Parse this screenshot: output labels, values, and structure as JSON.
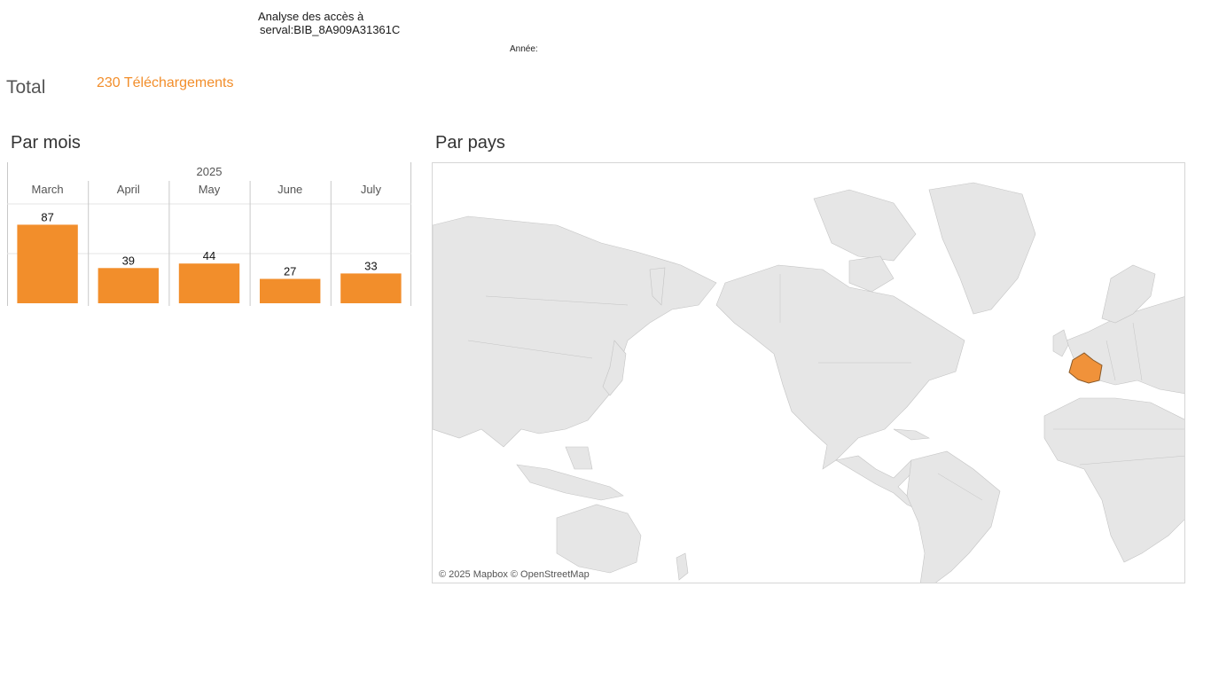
{
  "header": {
    "title_line1": "Analyse des accès à",
    "title_line2": "serval:BIB_8A909A31361C",
    "year_label": "Année:"
  },
  "summary": {
    "total_label": "Total",
    "total_value": "230 Téléchargements"
  },
  "sections": {
    "by_month": "Par mois",
    "by_country": "Par pays"
  },
  "chart_data": {
    "type": "bar",
    "group_label": "2025",
    "categories": [
      "March",
      "April",
      "May",
      "June",
      "July"
    ],
    "values": [
      87,
      39,
      44,
      27,
      33
    ],
    "show_data_labels": true,
    "grid": true
  },
  "map": {
    "attribution": "© 2025 Mapbox © OpenStreetMap",
    "highlighted_countries": [
      "France"
    ]
  },
  "colors": {
    "accent": "#f28e2b",
    "bar": "#f28e2b",
    "highlight_country": "#f0923a",
    "land": "#e6e6e6",
    "water": "#ffffff",
    "grid": "#e6e6e6",
    "axis": "#c8c8c8"
  }
}
